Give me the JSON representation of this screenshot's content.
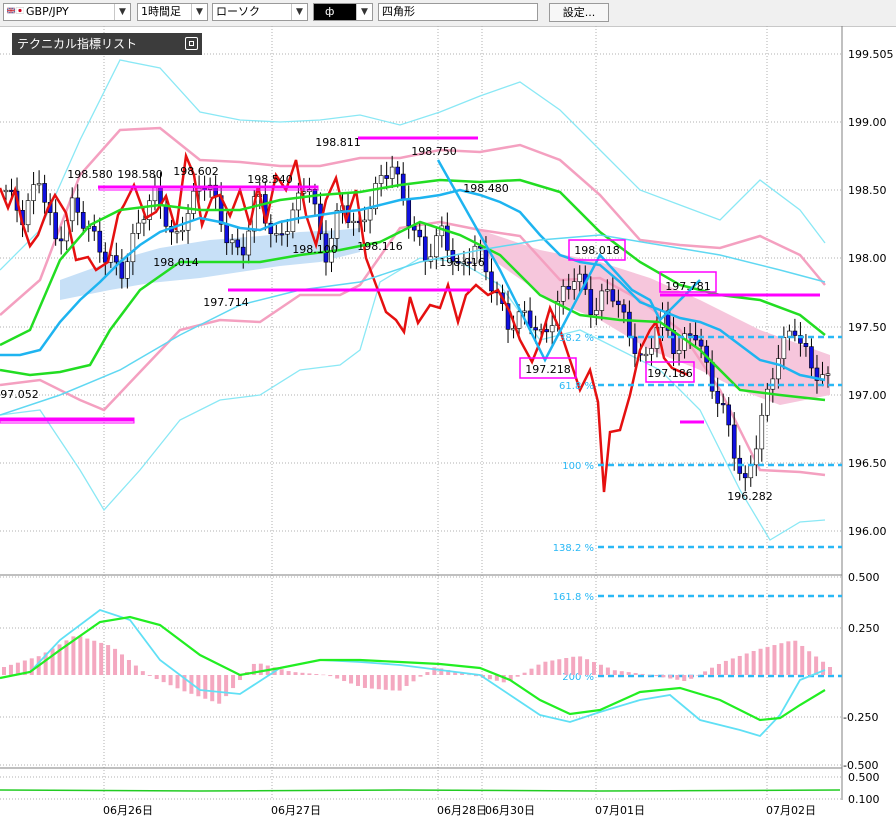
{
  "toolbar": {
    "symbol": "GBP/JPY",
    "timeframe": "1時間足",
    "chart_type": "ローソク",
    "tool_icon": "ф",
    "tool_shape": "四角形",
    "settings_label": "設定..."
  },
  "indicator_panel": {
    "title": "テクニカル指標リスト"
  },
  "colors": {
    "candle_up": "#ffffff",
    "candle_down": "#1010e0",
    "red_line": "#e51010",
    "cyan": "#1eb4f0",
    "green": "#22dd22",
    "pink": "#f4a0c0",
    "magenta": "#ff00ff",
    "fib": "#2ab8f5"
  },
  "chart_data": [
    {
      "type": "candlestick",
      "price_axis": {
        "min": 196.0,
        "max": 199.505,
        "ticks": [
          "199.505",
          "199.00",
          "198.50",
          "198.00",
          "197.50",
          "197.00",
          "196.50",
          "196.00"
        ]
      },
      "x_labels": [
        "06月26日",
        "06月27日",
        "06月28日",
        "06月30日",
        "07月01日",
        "07月02日"
      ],
      "price_labels": [
        "198.580",
        "198.580",
        "198.602",
        "198.540",
        "198.811",
        "198.750",
        "198.480",
        "198.014",
        "197.714",
        "198.100",
        "198.116",
        "198.016",
        "198.018",
        "197.781",
        "197.218",
        "197.186",
        "196.282",
        "197.052"
      ],
      "fib_labels": [
        "38.2 %",
        "61.8 %",
        "100 %",
        "138.2 %",
        "161.8 %"
      ],
      "series": [
        {
          "name": "close_line",
          "values": [
            198.5,
            198.3,
            198.6,
            198.1,
            198.4,
            198.2,
            198.0,
            197.9,
            198.3,
            198.5,
            198.1,
            198.4,
            198.6,
            198.2,
            198.0,
            198.5,
            198.1,
            198.3,
            198.6,
            198.0,
            198.4,
            198.2,
            198.5,
            198.7,
            198.3,
            198.0,
            198.2,
            197.9,
            198.1,
            197.8,
            197.5,
            197.6,
            197.4,
            197.7,
            197.9,
            197.6,
            197.8,
            197.5,
            197.2,
            197.6,
            197.3,
            197.5,
            197.1,
            196.8,
            196.3,
            196.8,
            197.3,
            197.5,
            197.2,
            197.1
          ]
        },
        {
          "name": "ma_cyan",
          "values": [
            197.3,
            197.4,
            197.6,
            197.8,
            198.0,
            198.1,
            198.2,
            198.2,
            198.2,
            198.2,
            198.3,
            198.3,
            198.3,
            198.4,
            198.5,
            198.6,
            198.5,
            198.4,
            198.3,
            198.1,
            197.9,
            197.7,
            197.6,
            197.5,
            197.4,
            197.3,
            197.2,
            197.1,
            197.1
          ]
        },
        {
          "name": "ma_green",
          "values": [
            197.2,
            197.5,
            197.8,
            198.0,
            198.2,
            198.3,
            198.4,
            198.5,
            198.5,
            198.5,
            198.6,
            198.6,
            198.5,
            198.3,
            198.1,
            197.9,
            197.7,
            197.6,
            197.5,
            197.5,
            197.4,
            197.3,
            197.2,
            197.0,
            196.9,
            196.8,
            196.8
          ]
        },
        {
          "name": "bollinger_pink",
          "values": [
            198.4,
            198.9,
            198.9,
            198.8,
            198.8,
            198.8,
            198.7,
            198.7,
            198.7,
            198.5,
            198.1,
            198.0,
            197.7,
            197.5,
            197.4,
            197.1,
            197.0,
            197.0
          ]
        },
        {
          "name": "bollinger_cyan",
          "values": [
            198.6,
            199.5,
            199.3,
            199.1,
            199.1,
            198.7,
            198.7,
            198.7,
            198.6,
            198.0,
            198.3,
            198.2,
            197.8,
            197.5,
            197.9,
            198.2,
            197.9
          ]
        }
      ]
    },
    {
      "type": "bar",
      "oscillator_axis": {
        "ticks": [
          "0.500",
          "0.250",
          "-0.250",
          "-0.500"
        ]
      },
      "fib_labels": [
        "200 %"
      ],
      "series": [
        {
          "name": "macd_hist",
          "values": [
            0.05,
            0.12,
            0.25,
            0.18,
            0.0,
            -0.1,
            -0.18,
            0.08,
            0.02,
            0.0,
            -0.08,
            -0.1,
            0.05,
            0.0,
            -0.05,
            0.08,
            0.12,
            0.03,
            0.0,
            -0.04,
            0.08,
            0.16,
            0.22,
            0.05
          ]
        },
        {
          "name": "macd_cyan",
          "values": [
            0.0,
            0.25,
            0.33,
            0.2,
            -0.1,
            0.05,
            0.1,
            0.05,
            0.0,
            -0.15,
            -0.28,
            -0.22,
            -0.15,
            -0.32,
            -0.12,
            0.0
          ]
        },
        {
          "name": "signal_green",
          "values": [
            0.0,
            0.18,
            0.3,
            0.25,
            0.1,
            0.05,
            0.08,
            0.06,
            0.0,
            -0.12,
            -0.25,
            -0.22,
            -0.12,
            -0.28,
            -0.08
          ]
        }
      ]
    },
    {
      "type": "line",
      "axis": {
        "ticks": [
          "0.500",
          "0.100"
        ]
      },
      "series": [
        {
          "name": "bottom_green",
          "values": [
            0.3,
            0.3,
            0.3,
            0.3,
            0.3
          ]
        }
      ]
    }
  ]
}
